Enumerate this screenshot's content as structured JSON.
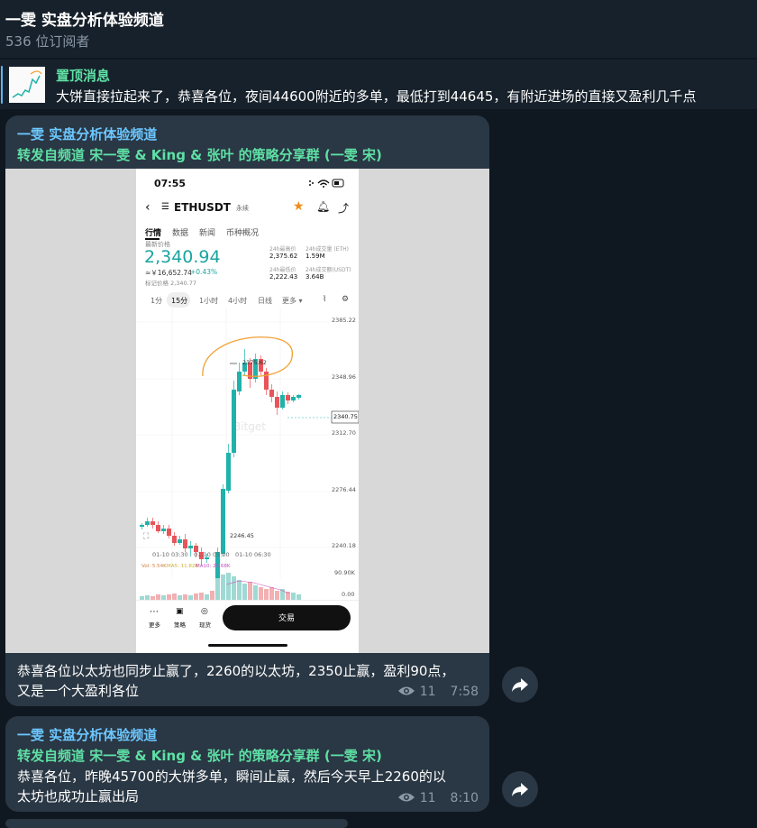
{
  "channel": {
    "title": "一雯 实盘分析体验频道",
    "subscribers": "536 位订阅者"
  },
  "pinned": {
    "title": "置顶消息",
    "text": "大饼直接拉起来了，恭喜各位，夜间44600附近的多单，最低打到44645，有附近进场的直接又盈利几千点"
  },
  "messages": [
    {
      "sender": "一雯 实盘分析体验频道",
      "forwarded": "转发自频道 宋一雯 & King & 张叶 的策略分享群 (一雯 宋)",
      "text_lines": [
        "恭喜各位以太坊也同步止赢了，2260的以太坊，2350止赢，盈利90点，",
        "又是一个大盈利各位"
      ],
      "views": "11",
      "time": "7:58"
    },
    {
      "sender": "一雯 实盘分析体验频道",
      "forwarded": "转发自频道 宋一雯 & King & 张叶 的策略分享群 (一雯 宋)",
      "text_lines": [
        "恭喜各位，昨晚45700的大饼多单，瞬间止赢，然后今天早上2260的以",
        "太坊也成功止赢出局"
      ],
      "views": "11",
      "time": "8:10"
    }
  ],
  "screenshot": {
    "status_time": "07:55",
    "symbol": "ETHUSDT",
    "symbol_tag": "永续",
    "tabs": [
      "行情",
      "数据",
      "新闻",
      "币种概况"
    ],
    "last_label": "最新价格",
    "price": "2,340.94",
    "cny": "≈￥16,652.74",
    "change": "+0.43%",
    "mark_price": "标记价格 2,340.77",
    "stats": {
      "high_label": "24h最高价",
      "high": "2,375.62",
      "vol_eth_label": "24h成交量 (ETH)",
      "vol_eth": "1.59M",
      "low_label": "24h最低价",
      "low": "2,222.43",
      "vol_usdt_label": "24h成交额(USDT)",
      "vol_usdt": "3.64B"
    },
    "intervals": [
      "1分",
      "15分",
      "1小时",
      "4小时",
      "日线",
      "更多 ▾"
    ],
    "axis_prices": [
      "2385.22",
      "2348.96",
      "2312.70",
      "2276.44",
      "2240.18"
    ],
    "current_tag": "2340.75",
    "high_mark": "2375.62",
    "low_mark": "2246.45",
    "time_labels": [
      "01-10 03:30",
      "01-10 05:00",
      "01-10 06:30"
    ],
    "watermark": "Bitget",
    "vol_legend": [
      "Vol: 5.54K",
      "MA5: 11.82K",
      "MA10: 25.68K"
    ],
    "vol_axis": [
      "90.90K",
      "0.00"
    ],
    "bottom_items": [
      "更多",
      "策略",
      "现货"
    ],
    "trade_button": "交易",
    "colors": {
      "up": "#20b2aa",
      "down": "#e8545a",
      "annotation": "#f0a030",
      "teal_text": "#1aa5a0"
    }
  }
}
